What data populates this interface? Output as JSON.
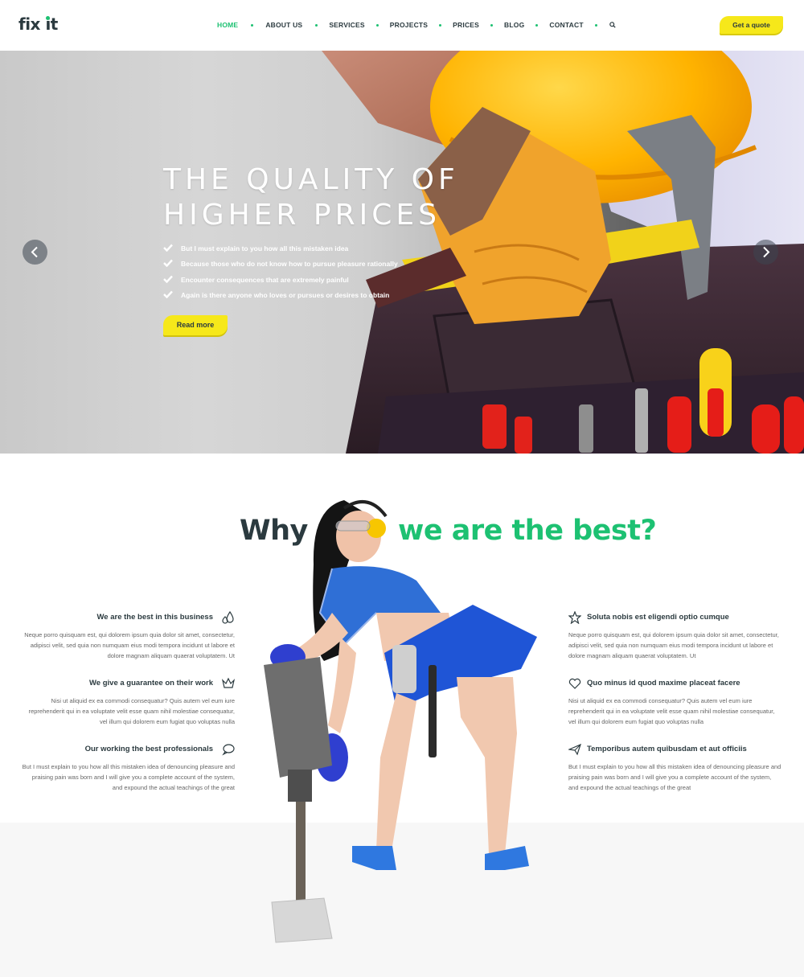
{
  "header": {
    "logo_fix": "fix",
    "logo_it": "it",
    "nav": [
      "HOME",
      "ABOUT US",
      "SERVICES",
      "PROJECTS",
      "PRICES",
      "BLOG",
      "CONTACT"
    ],
    "quote_button": "Get a quote"
  },
  "hero": {
    "title_line1": "THE QUALITY OF",
    "title_line2": "HIGHER PRICES",
    "bullets": [
      "But I must explain to you how all this mistaken idea",
      "Because those who do not know how to pursue pleasure rationally",
      "Encounter consequences that are extremely painful",
      "Again is there anyone who loves or pursues or desires to obtain"
    ],
    "read_more": "Read more"
  },
  "why": {
    "title_dark": "Why",
    "title_green": "we are the best?"
  },
  "features_left": [
    {
      "title": "We are the best in this business",
      "icon": "drops-icon",
      "text": "Neque porro quisquam est, qui dolorem ipsum quia dolor sit amet, consectetur, adipisci velit, sed quia non numquam eius modi tempora incidunt ut labore et dolore magnam aliquam quaerat voluptatem. Ut"
    },
    {
      "title": "We give a guarantee on their work",
      "icon": "crown-icon",
      "text": "Nisi ut aliquid ex ea commodi consequatur? Quis autem vel eum iure reprehenderit qui in ea voluptate velit esse quam nihil molestiae consequatur, vel illum qui dolorem eum fugiat quo voluptas nulla"
    },
    {
      "title": "Our working the best professionals",
      "icon": "chat-bubble-icon",
      "text": "But I must explain to you how all this mistaken idea of denouncing pleasure and praising pain was born and I will give you a complete account of the system, and expound the actual teachings of the great"
    }
  ],
  "features_right": [
    {
      "title": "Soluta nobis est eligendi optio cumque",
      "icon": "star-icon",
      "text": "Neque porro quisquam est, qui dolorem ipsum quia dolor sit amet, consectetur, adipisci velit, sed quia non numquam eius modi tempora incidunt ut labore et dolore magnam aliquam quaerat voluptatem. Ut"
    },
    {
      "title": "Quo minus id quod maxime placeat facere",
      "icon": "heart-icon",
      "text": "Nisi ut aliquid ex ea commodi consequatur? Quis autem vel eum iure reprehenderit qui in ea voluptate velit esse quam nihil molestiae consequatur, vel illum qui dolorem eum fugiat quo voluptas nulla"
    },
    {
      "title": "Temporibus autem quibusdam et aut officiis",
      "icon": "paper-plane-icon",
      "text": "But I must explain to you how all this mistaken idea of denouncing pleasure and praising pain was born and I will give you a complete account of the system, and expound the actual teachings of the great"
    }
  ],
  "colors": {
    "accent_green": "#1dc172",
    "accent_yellow": "#f6e81a",
    "dark_text": "#2b3a3f"
  }
}
